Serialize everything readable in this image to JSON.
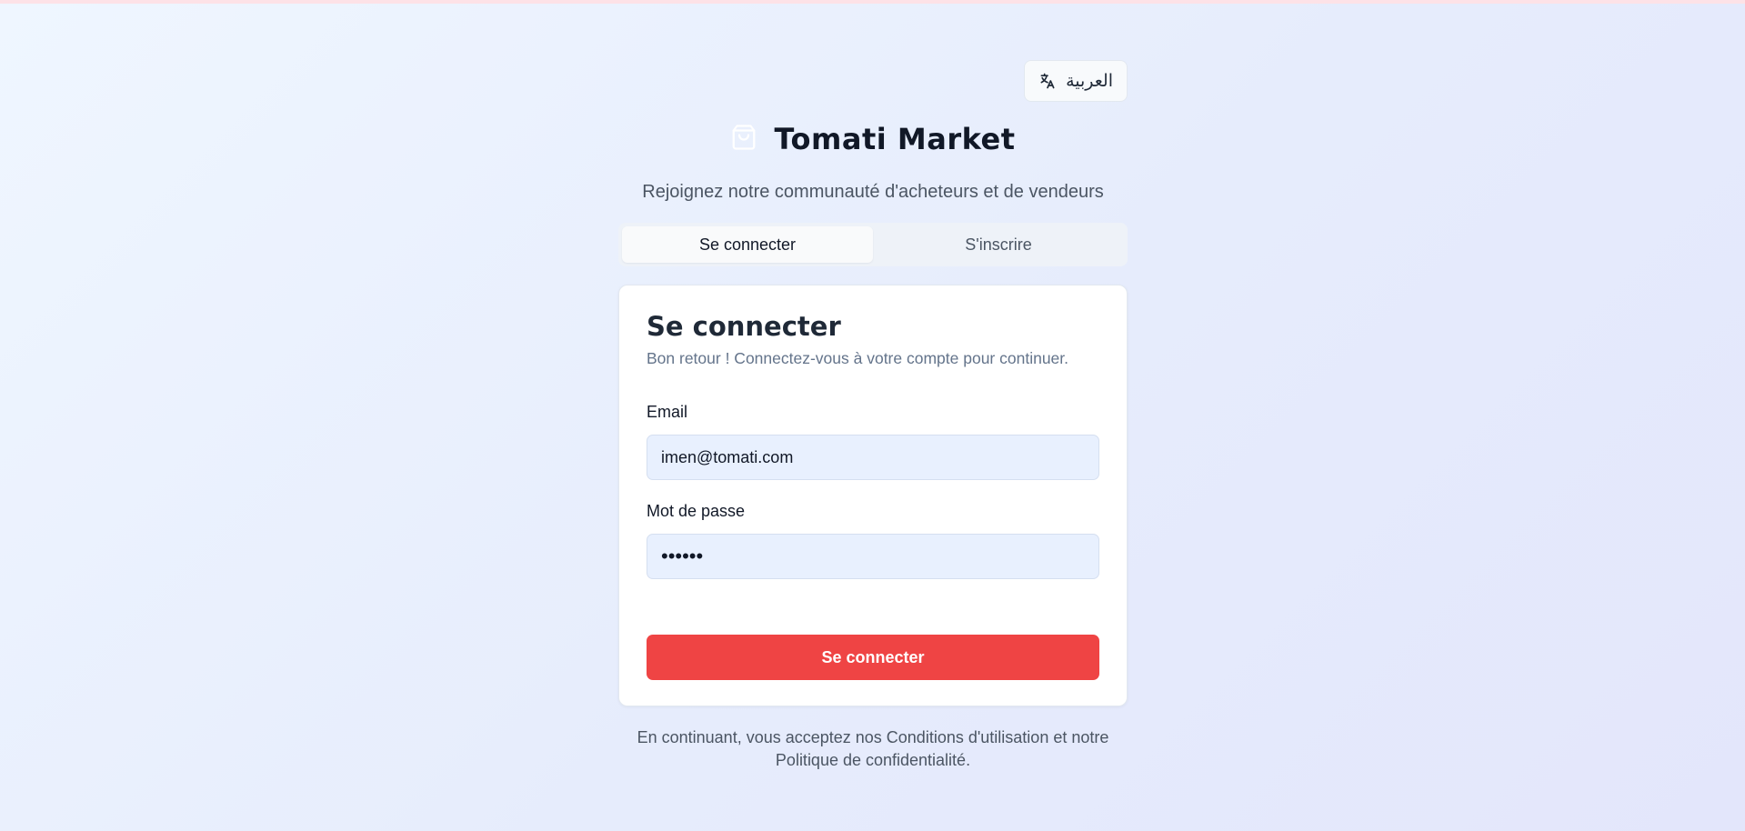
{
  "language_switch": {
    "label": "العربية",
    "icon": "translate-icon"
  },
  "brand": {
    "name": "Tomati Market",
    "icon": "shopping-bag-icon"
  },
  "subtitle": "Rejoignez notre communauté d'acheteurs et de vendeurs",
  "tabs": [
    {
      "label": "Se connecter",
      "active": true
    },
    {
      "label": "S'inscrire",
      "active": false
    }
  ],
  "login_card": {
    "title": "Se connecter",
    "description": "Bon retour ! Connectez-vous à votre compte pour continuer.",
    "email": {
      "label": "Email",
      "value": "imen@tomati.com"
    },
    "password": {
      "label": "Mot de passe",
      "value": "••••••"
    },
    "submit_label": "Se connecter"
  },
  "footer": {
    "line1": "En continuant, vous acceptez nos Conditions d'utilisation et notre",
    "line2": "Politique de confidentialité."
  },
  "colors": {
    "accent": "#ef4444",
    "input_bg": "#e8f0fe",
    "background_from": "#eff6ff",
    "background_to": "#e3e6fb"
  }
}
